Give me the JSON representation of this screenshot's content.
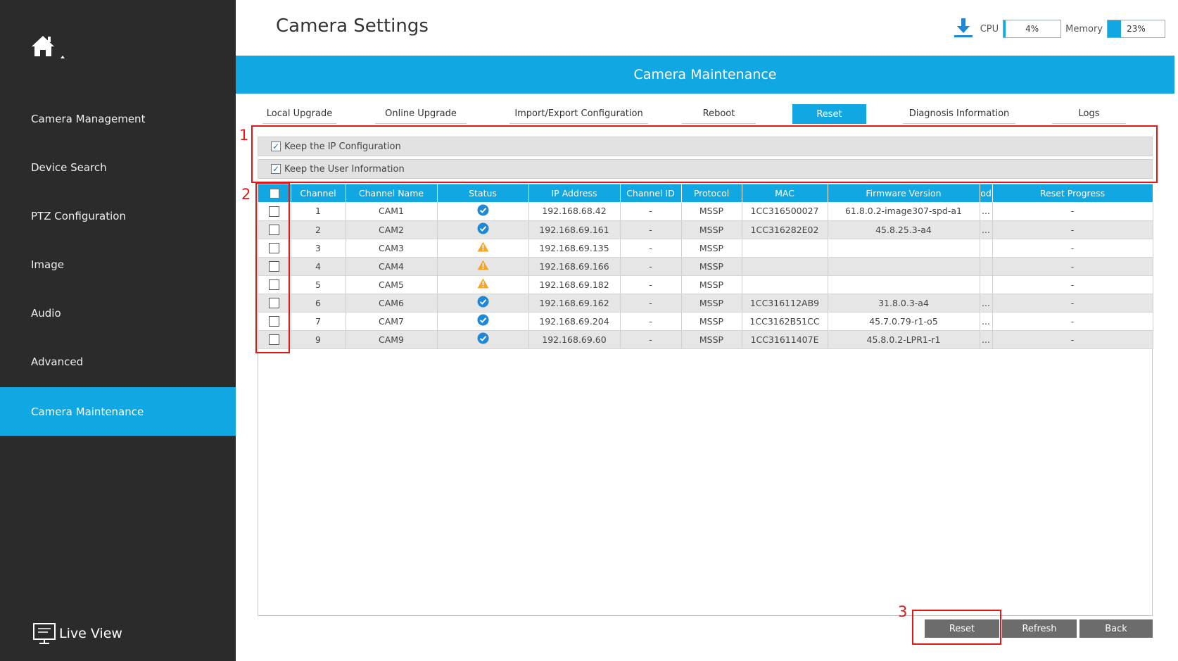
{
  "sidebar": {
    "home_icon": "home-icon",
    "items": [
      {
        "label": "Camera Management"
      },
      {
        "label": "Device Search"
      },
      {
        "label": "PTZ Configuration"
      },
      {
        "label": "Image"
      },
      {
        "label": "Audio"
      },
      {
        "label": "Advanced"
      },
      {
        "label": "Camera Maintenance",
        "active": true
      }
    ],
    "live_view": "Live View"
  },
  "header": {
    "title": "Camera Settings",
    "cpu_label": "CPU",
    "cpu_value": "4%",
    "cpu_percent": 4,
    "memory_label": "Memory",
    "memory_value": "23%",
    "memory_percent": 23
  },
  "banner": "Camera Maintenance",
  "tabs": [
    {
      "label": "Local Upgrade"
    },
    {
      "label": "Online Upgrade"
    },
    {
      "label": "Import/Export Configuration"
    },
    {
      "label": "Reboot"
    },
    {
      "label": "Reset",
      "active": true
    },
    {
      "label": "Diagnosis Information"
    },
    {
      "label": "Logs"
    }
  ],
  "options": {
    "keep_ip": {
      "label": "Keep the IP Configuration",
      "checked": true
    },
    "keep_user": {
      "label": "Keep the User Information",
      "checked": true
    }
  },
  "table": {
    "columns": [
      "Channel",
      "Channel Name",
      "Status",
      "IP Address",
      "Channel ID",
      "Protocol",
      "MAC",
      "Firmware Version",
      "od",
      "Reset Progress"
    ],
    "rows": [
      {
        "channel": "1",
        "name": "CAM1",
        "status": "ok",
        "ip": "192.168.68.42",
        "channel_id": "-",
        "protocol": "MSSP",
        "mac": "1CC316500027",
        "firmware": "61.8.0.2-image307-spd-a1",
        "od": "...",
        "progress": "-"
      },
      {
        "channel": "2",
        "name": "CAM2",
        "status": "ok",
        "ip": "192.168.69.161",
        "channel_id": "-",
        "protocol": "MSSP",
        "mac": "1CC316282E02",
        "firmware": "45.8.25.3-a4",
        "od": "...",
        "progress": "-"
      },
      {
        "channel": "3",
        "name": "CAM3",
        "status": "warning",
        "ip": "192.168.69.135",
        "channel_id": "-",
        "protocol": "MSSP",
        "mac": "",
        "firmware": "",
        "od": "",
        "progress": "-"
      },
      {
        "channel": "4",
        "name": "CAM4",
        "status": "warning",
        "ip": "192.168.69.166",
        "channel_id": "-",
        "protocol": "MSSP",
        "mac": "",
        "firmware": "",
        "od": "",
        "progress": "-"
      },
      {
        "channel": "5",
        "name": "CAM5",
        "status": "warning",
        "ip": "192.168.69.182",
        "channel_id": "-",
        "protocol": "MSSP",
        "mac": "",
        "firmware": "",
        "od": "",
        "progress": "-"
      },
      {
        "channel": "6",
        "name": "CAM6",
        "status": "ok",
        "ip": "192.168.69.162",
        "channel_id": "-",
        "protocol": "MSSP",
        "mac": "1CC316112AB9",
        "firmware": "31.8.0.3-a4",
        "od": "...",
        "progress": "-"
      },
      {
        "channel": "7",
        "name": "CAM7",
        "status": "ok",
        "ip": "192.168.69.204",
        "channel_id": "-",
        "protocol": "MSSP",
        "mac": "1CC3162B51CC",
        "firmware": "45.7.0.79-r1-o5",
        "od": "...",
        "progress": "-"
      },
      {
        "channel": "9",
        "name": "CAM9",
        "status": "ok",
        "ip": "192.168.69.60",
        "channel_id": "-",
        "protocol": "MSSP",
        "mac": "1CC31611407E",
        "firmware": "45.8.0.2-LPR1-r1",
        "od": "...",
        "progress": "-"
      }
    ]
  },
  "buttons": {
    "reset": "Reset",
    "refresh": "Refresh",
    "back": "Back"
  },
  "annotations": {
    "one": "1",
    "two": "2",
    "three": "3"
  },
  "colors": {
    "accent": "#10a7e3",
    "sidebar": "#2b2b2b",
    "annotation": "#e01818",
    "ok": "#1e88d8",
    "warning": "#f5a623"
  }
}
